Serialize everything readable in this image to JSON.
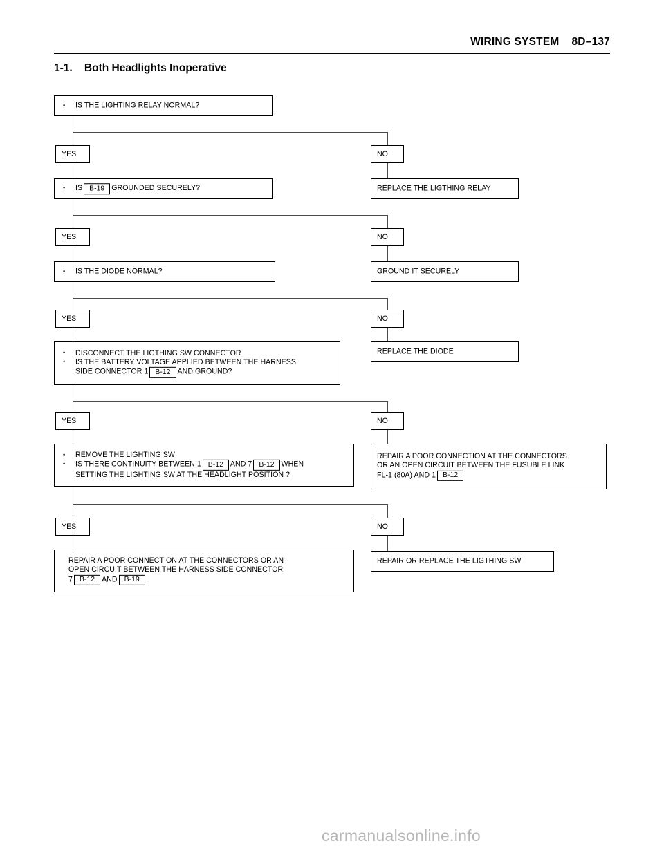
{
  "header": {
    "title": "WIRING SYSTEM    8D–137",
    "section_number": "1-1.",
    "section_title": "Both Headlights Inoperative",
    "section_heading": "1-1.    Both Headlights Inoperative"
  },
  "flow": {
    "branch_yes_label": "YES",
    "branch_no_label": "NO",
    "steps": [
      {
        "id": "step-1",
        "question": {
          "lines": [
            "IS THE LIGHTING RELAY NORMAL?"
          ]
        },
        "yes_label": "YES",
        "no_label": "NO",
        "no_result": "REPLACE THE LIGTHING RELAY"
      },
      {
        "id": "step-2",
        "question": {
          "pre": "IS",
          "chip": "B-19",
          "post": "GROUNDED SECURELY?"
        },
        "yes_label": "YES",
        "no_label": "NO",
        "no_result": "GROUND IT SECURELY"
      },
      {
        "id": "step-3",
        "question": {
          "lines": [
            "IS THE DIODE NORMAL?"
          ]
        },
        "yes_label": "YES",
        "no_label": "NO",
        "no_result": "REPLACE THE DIODE"
      },
      {
        "id": "step-4",
        "question": {
          "bullet1": "DISCONNECT THE LIGTHING SW CONNECTOR",
          "bullet2_a": "IS THE BATTERY VOLTAGE APPLIED BETWEEN THE HARNESS",
          "bullet2_b_pre": "SIDE CONNECTOR 1",
          "bullet2_b_chip": "B-12",
          "bullet2_b_post": "AND GROUND?"
        },
        "yes_label": "YES",
        "no_label": "NO",
        "no_result": "REPLACE THE DIODE"
      },
      {
        "id": "step-5",
        "question": {
          "bullet1": "REMOVE THE LIGHTING SW",
          "bullet2_pre": "IS THERE CONTINUITY BETWEEN 1",
          "bullet2_chip1": "B-12",
          "bullet2_mid": "AND 7",
          "bullet2_chip2": "B-12",
          "bullet2_post": "WHEN",
          "bullet2_line2": "SETTING THE LIGHTING SW AT THE   HEADLIGHT POSITION ?"
        },
        "yes_label": "YES",
        "no_label": "NO",
        "no_result_line1": "REPAIR A POOR CONNECTION AT THE CONNECTORS",
        "no_result_line2": "OR AN OPEN CIRCUIT BETWEEN THE FUSUBLE LINK",
        "no_result_line3_pre": "FL-1 (80A) AND 1",
        "no_result_line3_chip": "B-12"
      },
      {
        "id": "step-6",
        "yes_label": "YES",
        "no_label": "NO",
        "yes_result_line1": "REPAIR  A POOR CONNECTION AT THE CONNECTORS OR AN",
        "yes_result_line2": "OPEN CIRCUIT BETWEEN THE HARNESS SIDE CONNECTOR",
        "yes_result_line3_pre": "7",
        "yes_result_line3_chip1": "B-12",
        "yes_result_line3_mid": "AND",
        "yes_result_line3_chip2": "B-19",
        "no_result": "REPAIR OR REPLACE THE LIGTHING SW"
      }
    ]
  },
  "watermark": "carmanualsonline.info"
}
